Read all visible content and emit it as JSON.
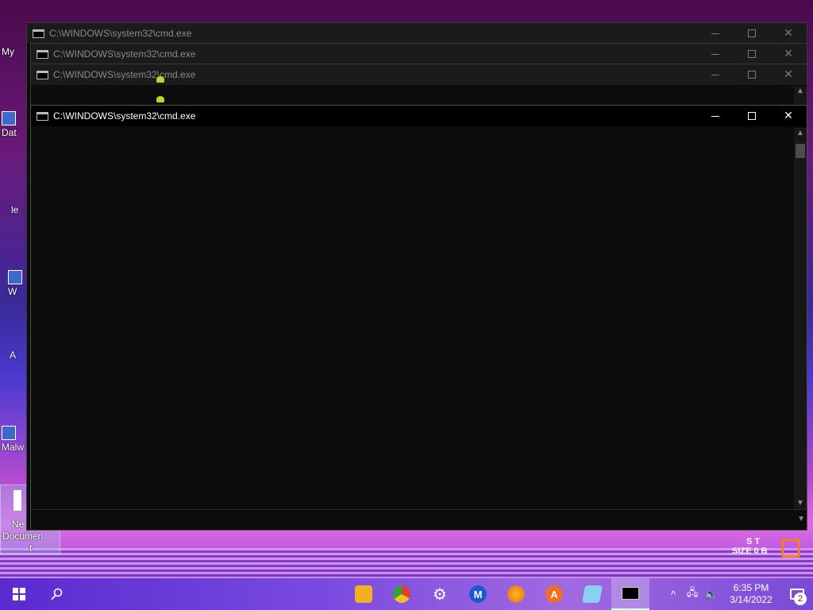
{
  "windows": [
    {
      "title": "C:\\WINDOWS\\system32\\cmd.exe"
    },
    {
      "title": "C:\\WINDOWS\\system32\\cmd.exe"
    },
    {
      "title": "C:\\WINDOWS\\system32\\cmd.exe"
    },
    {
      "title": "C:\\WINDOWS\\system32\\cmd.exe"
    }
  ],
  "desktop_icons": [
    {
      "label": "My"
    },
    {
      "label": "Dat"
    },
    {
      "label": "le"
    },
    {
      "label": "W"
    },
    {
      "label": "A"
    },
    {
      "label": "Malw"
    },
    {
      "label": "Ne"
    },
    {
      "label": "Documen"
    },
    {
      "label": "t"
    }
  ],
  "status_overlay": {
    "line1": "S T",
    "line2": "SIZE 0 B"
  },
  "taskbar": {
    "apps": [
      {
        "icon": "file-explorer-icon",
        "color": "#f0b020"
      },
      {
        "icon": "chrome-icon",
        "color": "#30a040"
      },
      {
        "icon": "settings-icon",
        "color": "#ffffff"
      },
      {
        "icon": "malwarebytes-icon",
        "color": "#1a5ad0"
      },
      {
        "icon": "firefox-icon",
        "color": "#f06020"
      },
      {
        "icon": "avast-icon",
        "color": "#f07020"
      },
      {
        "icon": "notepad-icon",
        "color": "#8ad0f0"
      },
      {
        "icon": "cmd-icon",
        "color": "#000000",
        "active": true
      }
    ],
    "clock": {
      "time": "6:35 PM",
      "date": "3/14/2022"
    },
    "notifications_count": "2"
  }
}
